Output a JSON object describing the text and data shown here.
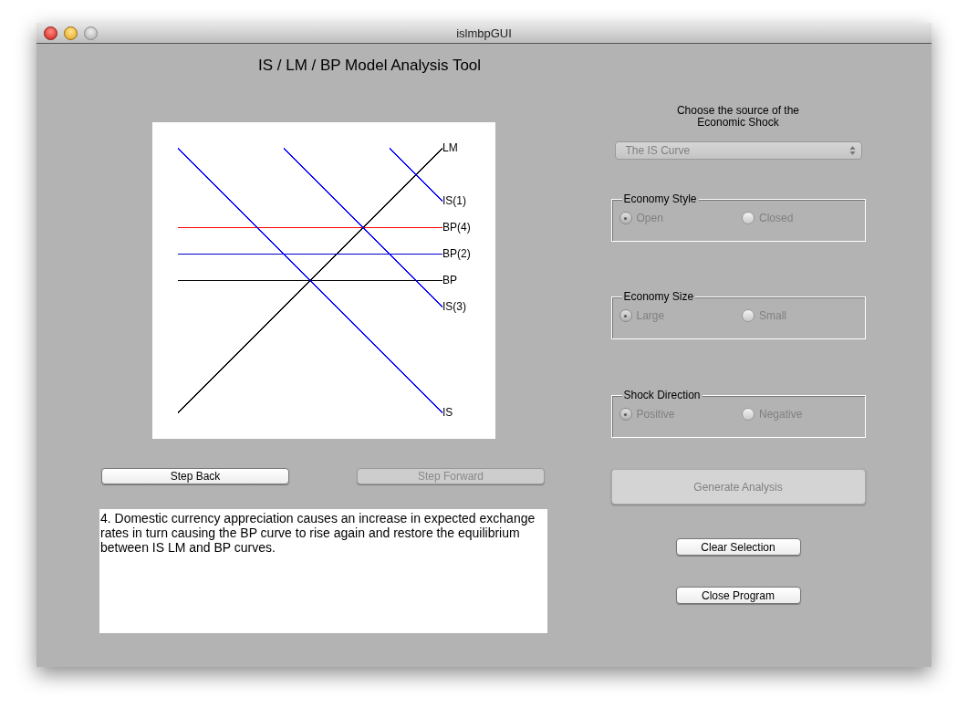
{
  "window": {
    "title": "islmbpGUI"
  },
  "heading": "IS / LM / BP Model Analysis Tool",
  "diagram": {
    "curves": [
      {
        "label": "LM",
        "color": "#000000"
      },
      {
        "label": "IS(1)",
        "color": "#0000ff"
      },
      {
        "label": "BP(4)",
        "color": "#ff0000"
      },
      {
        "label": "BP(2)",
        "color": "#0000cc"
      },
      {
        "label": "BP",
        "color": "#000000"
      },
      {
        "label": "IS(3)",
        "color": "#0000ff"
      },
      {
        "label": "IS",
        "color": "#0000ff"
      }
    ]
  },
  "step_buttons": [
    {
      "label": "Step Back",
      "disabled": false
    },
    {
      "label": "Step Forward",
      "disabled": true
    }
  ],
  "explanation": "4. Domestic currency appreciation causes an increase in expected exchange rates in turn causing the BP curve to rise again and restore the equilibrium between IS LM and BP curves.",
  "shock_source": {
    "label": "Choose the source of the Economic Shock",
    "value": "The IS Curve",
    "disabled": true
  },
  "groups": [
    {
      "title": "Economy Style",
      "disabled": true,
      "options": [
        {
          "label": "Open",
          "selected": true
        },
        {
          "label": "Closed",
          "selected": false
        }
      ]
    },
    {
      "title": "Economy Size",
      "disabled": true,
      "options": [
        {
          "label": "Large",
          "selected": true
        },
        {
          "label": "Small",
          "selected": false
        }
      ]
    },
    {
      "title": "Shock Direction",
      "disabled": true,
      "options": [
        {
          "label": "Positive",
          "selected": true
        },
        {
          "label": "Negative",
          "selected": false
        }
      ]
    }
  ],
  "generate_button": {
    "label": "Generate Analysis",
    "disabled": true
  },
  "buttons": [
    {
      "label": "Clear Selection"
    },
    {
      "label": "Close Program"
    }
  ]
}
